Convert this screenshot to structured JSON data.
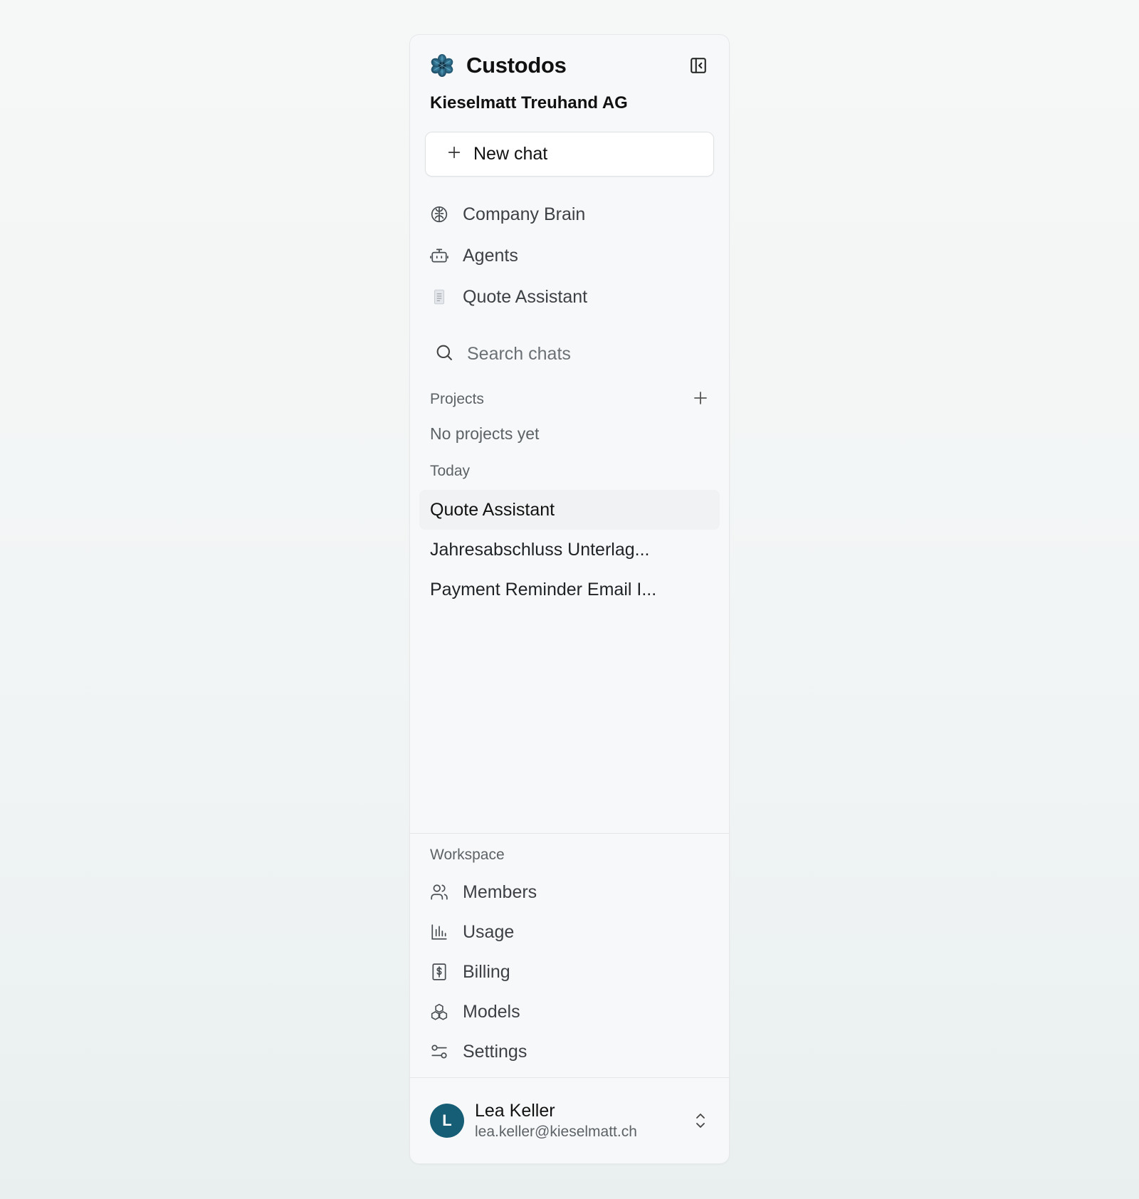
{
  "app": {
    "name": "Custodos",
    "organization": "Kieselmatt Treuhand AG"
  },
  "new_chat": {
    "label": "New chat"
  },
  "nav": [
    {
      "label": "Company Brain",
      "icon": "brain-icon"
    },
    {
      "label": "Agents",
      "icon": "bot-icon"
    },
    {
      "label": "Quote Assistant",
      "icon": "document-icon"
    }
  ],
  "search": {
    "placeholder": "Search chats"
  },
  "projects": {
    "label": "Projects",
    "empty": "No projects yet"
  },
  "history": {
    "label": "Today",
    "items": [
      {
        "title": "Quote Assistant",
        "active": true
      },
      {
        "title": "Jahresabschluss Unterlag..."
      },
      {
        "title": "Payment Reminder Email I..."
      }
    ]
  },
  "workspace": {
    "label": "Workspace",
    "items": [
      {
        "label": "Members",
        "icon": "users-icon"
      },
      {
        "label": "Usage",
        "icon": "bar-chart-icon"
      },
      {
        "label": "Billing",
        "icon": "receipt-dollar-icon"
      },
      {
        "label": "Models",
        "icon": "cubes-icon"
      },
      {
        "label": "Settings",
        "icon": "sliders-icon"
      }
    ]
  },
  "user": {
    "initial": "L",
    "name": "Lea Keller",
    "email": "lea.keller@kieselmatt.ch"
  },
  "colors": {
    "avatar": "#155e75",
    "logo": "#1e5a78",
    "background": "#f7f8f9"
  }
}
